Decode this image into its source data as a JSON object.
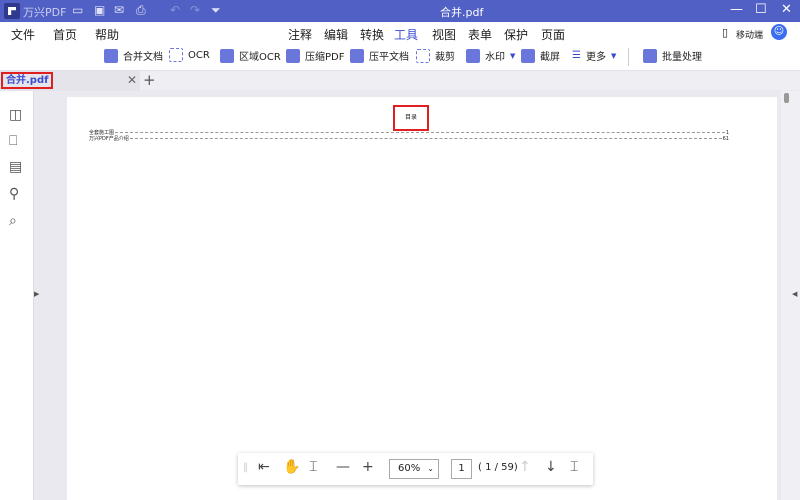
{
  "titlebar": {
    "app_name": "万兴PDF",
    "doc_title": "合并.pdf"
  },
  "menu": {
    "left": [
      "文件",
      "首页",
      "帮助"
    ],
    "center": [
      "注释",
      "编辑",
      "转换",
      "工具",
      "视图",
      "表单",
      "保护",
      "页面"
    ],
    "active": "工具",
    "mobile": "移动端"
  },
  "toolbar": [
    "合并文档",
    "OCR",
    "区域OCR",
    "压缩PDF",
    "压平文档",
    "裁剪",
    "水印",
    "截屏",
    "更多",
    "批量处理"
  ],
  "tab": {
    "label": "合并.pdf"
  },
  "document": {
    "toc_title": "目录",
    "toc": [
      {
        "title": "全套施工图",
        "page": "1"
      },
      {
        "title": "万兴PDF产品介绍",
        "page": "61"
      }
    ]
  },
  "bottombar": {
    "zoom": "60%",
    "page_input": "1",
    "page_count": "( 1 / 59)"
  },
  "colors": {
    "titlebar": "#5160c4",
    "accent": "#3a4bd1",
    "highlight": "#e02020"
  }
}
